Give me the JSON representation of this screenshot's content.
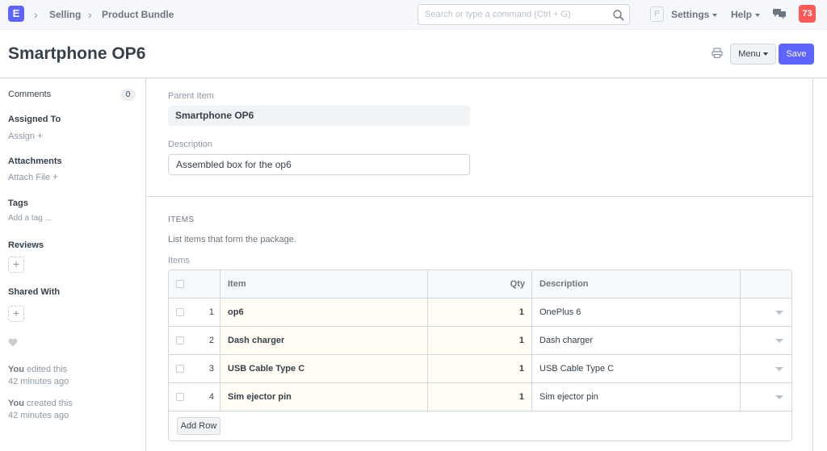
{
  "navbar": {
    "logo": "E",
    "breadcrumbs": [
      "Selling",
      "Product Bundle"
    ],
    "search_placeholder": "Search or type a command (Ctrl + G)",
    "user_initial": "P",
    "settings_label": "Settings",
    "help_label": "Help",
    "notification_count": "73"
  },
  "page": {
    "title": "Smartphone OP6",
    "menu_label": "Menu",
    "save_label": "Save"
  },
  "sidebar": {
    "comments_label": "Comments",
    "comments_count": "0",
    "assigned_label": "Assigned To",
    "assign_action": "Assign",
    "attachments_label": "Attachments",
    "attach_action": "Attach File",
    "tags_label": "Tags",
    "tag_placeholder": "Add a tag ...",
    "reviews_label": "Reviews",
    "shared_label": "Shared With",
    "activity": [
      {
        "who": "You",
        "what": " edited this",
        "when": "42 minutes ago"
      },
      {
        "who": "You",
        "what": " created this",
        "when": "42 minutes ago"
      }
    ]
  },
  "form": {
    "parent_item_label": "Parent Item",
    "parent_item_value": "Smartphone OP6",
    "description_label": "Description",
    "description_value": "Assembled box for the op6",
    "section_title": "ITEMS",
    "section_description": "List items that form the package.",
    "items_label": "Items"
  },
  "grid": {
    "headers": {
      "item": "Item",
      "qty": "Qty",
      "description": "Description"
    },
    "rows": [
      {
        "idx": "1",
        "item": "op6",
        "qty": "1",
        "description": "OnePlus 6"
      },
      {
        "idx": "2",
        "item": "Dash charger",
        "qty": "1",
        "description": "Dash charger"
      },
      {
        "idx": "3",
        "item": "USB Cable Type C",
        "qty": "1",
        "description": "USB Cable Type C"
      },
      {
        "idx": "4",
        "item": "Sim ejector pin",
        "qty": "1",
        "description": "Sim ejector pin"
      }
    ],
    "add_row_label": "Add Row"
  },
  "colors": {
    "primary": "#5e64ff",
    "notification": "#ff5858",
    "editable_cell": "#fffdf4"
  }
}
